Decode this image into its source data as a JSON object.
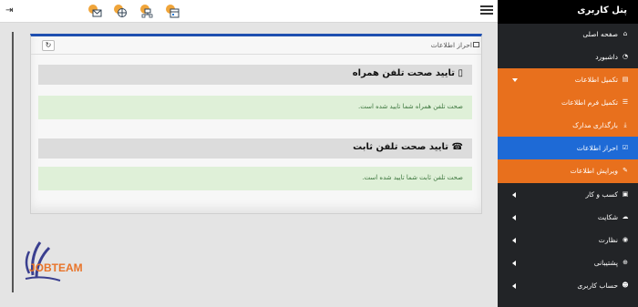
{
  "sidebar": {
    "title": "پنل کاربری",
    "items": [
      {
        "label": "صفحه اصلی",
        "icon": "home-icon"
      },
      {
        "label": "داشبورد",
        "icon": "dashboard-icon"
      },
      {
        "label": "تکمیل اطلاعات",
        "icon": "id-card-icon",
        "expanded": true
      },
      {
        "label": "تکمیل فرم اطلاعات",
        "icon": "list-icon"
      },
      {
        "label": "بارگذاری مدارک",
        "icon": "upload-icon"
      },
      {
        "label": "احراز اطلاعات",
        "icon": "check-square-icon",
        "active": true
      },
      {
        "label": "ویرایش اطلاعات",
        "icon": "edit-icon"
      },
      {
        "label": "کسب و کار",
        "icon": "briefcase-icon"
      },
      {
        "label": "شکایت",
        "icon": "cloud-icon"
      },
      {
        "label": "نظارت",
        "icon": "eye-icon"
      },
      {
        "label": "پشتیبانی",
        "icon": "support-icon"
      },
      {
        "label": "حساب کاربری",
        "icon": "user-icon"
      }
    ]
  },
  "panel": {
    "title": "احراز اطلاعات",
    "sections": [
      {
        "title": "تایید صحت تلفن همراه",
        "icon": "mobile-icon",
        "message": "صحت تلفن همراه شما تایید شده است."
      },
      {
        "title": "تایید صحت تلفن ثابت",
        "icon": "phone-icon",
        "message": "صحت تلفن ثابت شما تایید شده است."
      }
    ]
  },
  "logo": {
    "text": "JOBTEAM"
  },
  "colors": {
    "sidebar": "#222427",
    "submenu": "#e8701d",
    "active": "#1e6ad6",
    "panel_border": "#1e4fb0",
    "alert_bg": "#dff0d8",
    "alert_text": "#3c763d"
  }
}
